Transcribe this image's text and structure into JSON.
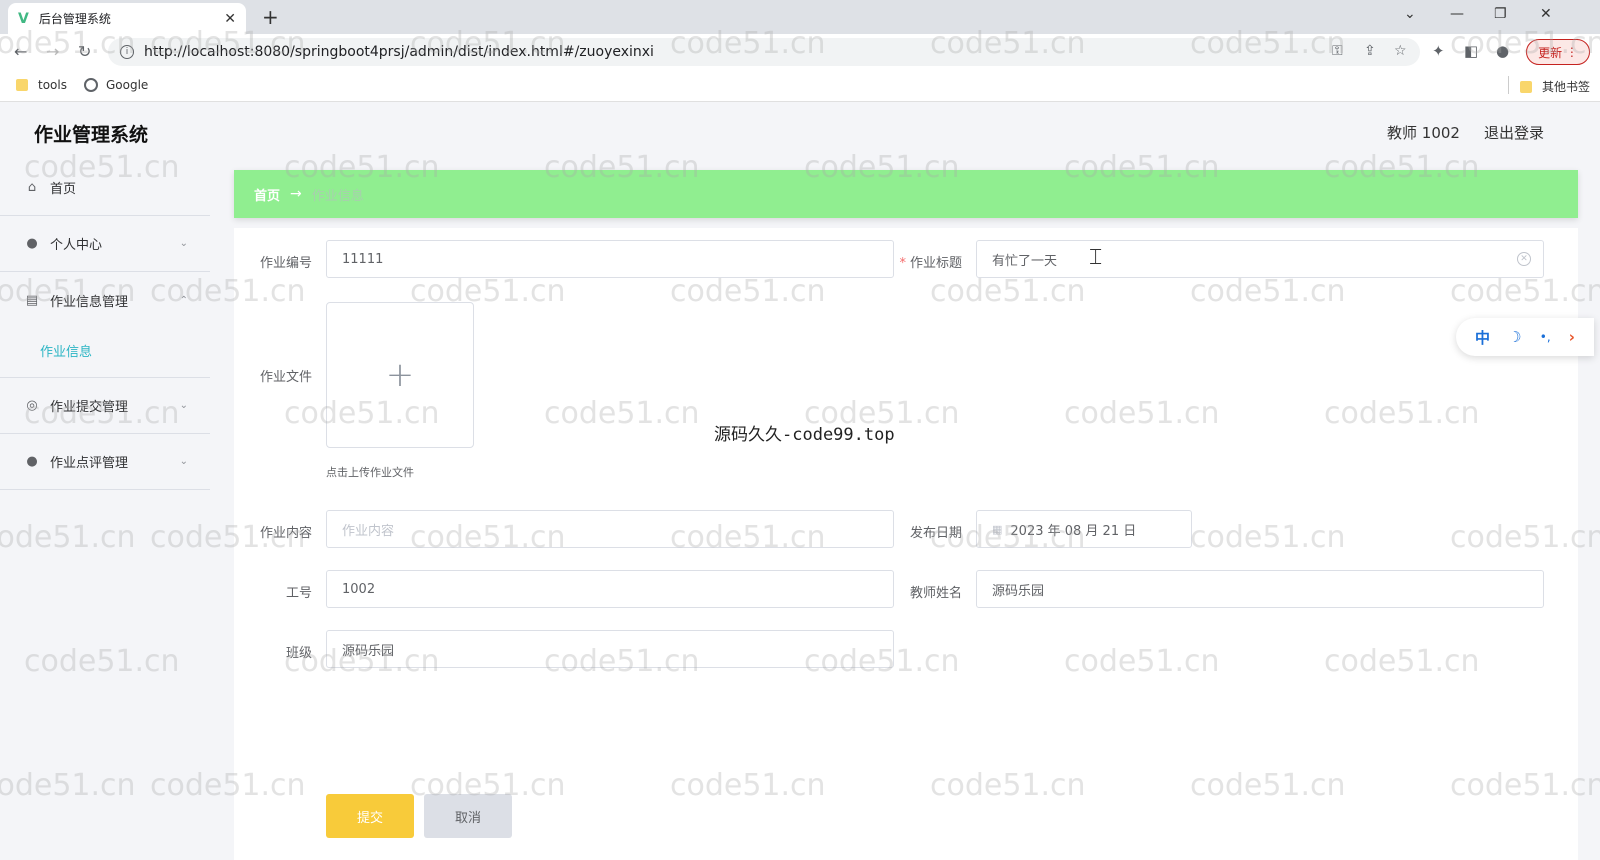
{
  "browser": {
    "tab_title": "后台管理系统",
    "tab_logo": "V",
    "url": "http://localhost:8080/springboot4prsj/admin/dist/index.html#/zuoyexinxi",
    "update_label": "更新",
    "bookmarks": [
      {
        "label": "tools",
        "icon": "folder-icon"
      },
      {
        "label": "Google",
        "icon": "globe-icon"
      }
    ],
    "other_bookmarks": "其他书签"
  },
  "app": {
    "title": "作业管理系统",
    "user": "教师 1002",
    "logout": "退出登录"
  },
  "sidebar": {
    "items": [
      {
        "label": "首页",
        "icon": "home-icon"
      },
      {
        "label": "个人中心",
        "icon": "user-icon"
      },
      {
        "label": "作业信息管理",
        "icon": "form-icon"
      },
      {
        "label": "作业提交管理",
        "icon": "submit-icon"
      },
      {
        "label": "作业点评管理",
        "icon": "user-icon"
      }
    ],
    "submenu": "作业信息"
  },
  "breadcrumb": {
    "home": "首页",
    "arrow": "→",
    "current": "作业信息"
  },
  "form": {
    "zuoye_bianhao": {
      "label": "作业编号",
      "value": "11111"
    },
    "zuoye_biaoti": {
      "label": "作业标题",
      "value": "有忙了一天",
      "required": "*"
    },
    "zuoye_wenjian": {
      "label": "作业文件",
      "tip": "点击上传作业文件",
      "plus": "+"
    },
    "zuoye_neirong": {
      "label": "作业内容",
      "placeholder": "作业内容"
    },
    "fabu_riqi": {
      "label": "发布日期",
      "value": "2023 年 08 月 21 日"
    },
    "gonghao": {
      "label": "工号",
      "value": "1002"
    },
    "jiaoshi_xingming": {
      "label": "教师姓名",
      "value": "源码乐园"
    },
    "banji": {
      "label": "班级",
      "value": "源码乐园"
    },
    "submit": "提交",
    "cancel": "取消"
  },
  "ime": {
    "lang": "中",
    "moon": "☽",
    "dots": "•,",
    "arrow": "›"
  },
  "overlay": {
    "center_text": "源码久久-code99.top",
    "watermark": "code51.cn"
  }
}
